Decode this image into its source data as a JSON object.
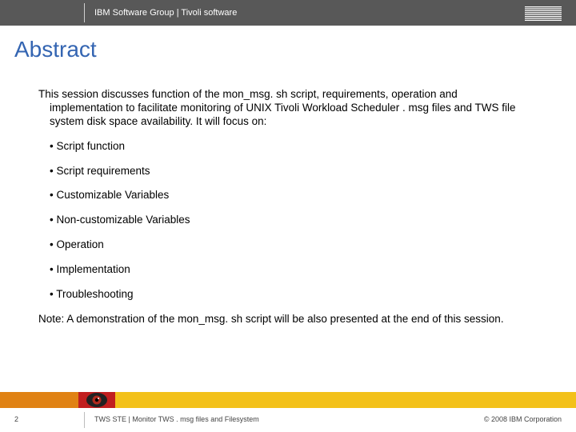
{
  "header": {
    "text": "IBM Software Group  |  Tivoli software",
    "logo_alt": "IBM"
  },
  "title": "Abstract",
  "intro": "This session discusses function of the mon_msg. sh script, requirements, operation and implementation to facilitate monitoring of UNIX Tivoli Workload Scheduler . msg files and TWS file system disk space availability. It will focus on:",
  "bullets": [
    "Script function",
    "Script requirements",
    "Customizable Variables",
    "Non-customizable Variables",
    "Operation",
    "Implementation",
    "Troubleshooting"
  ],
  "note": "Note: A demonstration of the mon_msg. sh script will be also presented at the end of this session.",
  "footer": {
    "page": "2",
    "center": "TWS STE | Monitor TWS . msg files and Filesystem",
    "right": "© 2008 IBM Corporation"
  }
}
